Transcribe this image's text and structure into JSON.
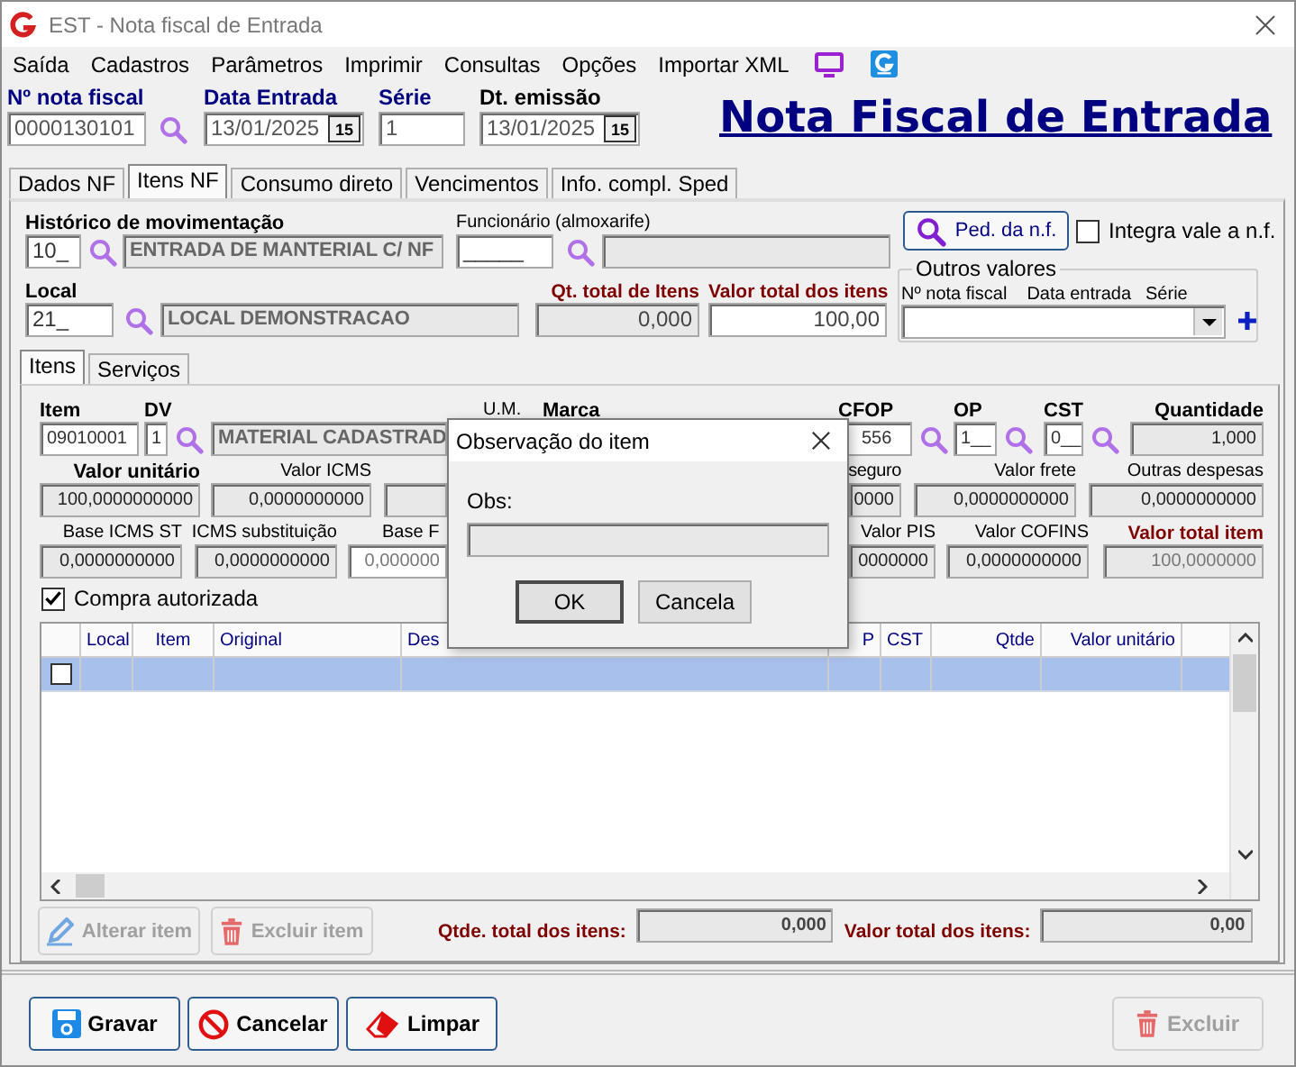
{
  "window": {
    "title": "EST - Nota fiscal de Entrada"
  },
  "menu": [
    "Saída",
    "Cadastros",
    "Parâmetros",
    "Imprimir",
    "Consultas",
    "Opções",
    "Importar XML"
  ],
  "header_fields": [
    {
      "label": "Nº nota fiscal",
      "value": "0000130101",
      "kind": "search"
    },
    {
      "label": "Data Entrada",
      "value": "13/01/2025",
      "kind": "date",
      "button": "15"
    },
    {
      "label": "Série",
      "value": "1",
      "kind": "plain"
    },
    {
      "label": "Dt. emissão",
      "value": "13/01/2025",
      "kind": "date",
      "button": "15"
    }
  ],
  "page_title": "Nota Fiscal de Entrada",
  "tabs": [
    {
      "label": "Dados NF",
      "selected": false
    },
    {
      "label": "Itens NF",
      "selected": true
    },
    {
      "label": "Consumo direto",
      "selected": false
    },
    {
      "label": "Vencimentos",
      "selected": false
    },
    {
      "label": "Info. compl. Sped",
      "selected": false
    }
  ],
  "movimentacao": {
    "label": "Histórico de movimentação",
    "code": "10_",
    "description": "ENTRADA DE MANTERIAL C/ NF"
  },
  "funcionario": {
    "label": "Funcionário (almoxarife)",
    "code": "_____"
  },
  "pedido_button": "Ped. da n.f.",
  "integra_vale": {
    "label": "Integra vale a n.f.",
    "checked": false
  },
  "local": {
    "label": "Local",
    "code": "21_",
    "description": "LOCAL DEMONSTRACAO"
  },
  "totals": [
    {
      "label": "Qt. total de Itens",
      "value": "0,000",
      "readonly": true
    },
    {
      "label": "Valor total dos itens",
      "value": "100,00",
      "readonly": false
    }
  ],
  "outros_valores": {
    "title": "Outros valores",
    "columns": [
      "Nº nota fiscal",
      "Data entrada",
      "Série"
    ]
  },
  "subtabs": [
    {
      "label": "Itens",
      "selected": true
    },
    {
      "label": "Serviços",
      "selected": false
    }
  ],
  "item_rows": [
    [
      {
        "label": "Item",
        "kind": "edit",
        "value": "09010001"
      },
      {
        "label": "DV",
        "kind": "edit",
        "value": "1"
      },
      {
        "kind": "description",
        "value": "MATERIAL CADASTRAD"
      },
      {
        "label": "U.M.",
        "kind": "label"
      },
      {
        "label": "Marca",
        "kind": "label"
      },
      {
        "label": "CFOP",
        "kind": "edit",
        "value": "556"
      },
      {
        "label": "OP",
        "kind": "edit",
        "value": "1__"
      },
      {
        "label": "CST",
        "kind": "edit",
        "value": "0__"
      },
      {
        "label": "Quantidade",
        "kind": "readonly",
        "value": "1,000"
      }
    ],
    [
      {
        "label": "Valor unitário",
        "kind": "readonly",
        "value": "100,0000000000"
      },
      {
        "label": "Valor ICMS",
        "kind": "readonly",
        "value": "0,0000000000"
      },
      {
        "kind": "readonly"
      },
      {
        "label": "seguro",
        "kind": "readonly",
        "value": "0000"
      },
      {
        "label": "Valor frete",
        "kind": "readonly",
        "value": "0,0000000000"
      },
      {
        "label": "Outras despesas",
        "kind": "readonly",
        "value": "0,0000000000"
      }
    ],
    [
      {
        "label": "Base ICMS ST",
        "kind": "readonly",
        "value": "0,0000000000"
      },
      {
        "label": "ICMS substituição",
        "kind": "readonly",
        "value": "0,0000000000"
      },
      {
        "label": "Base F",
        "kind": "edit",
        "value": "0,000000"
      },
      {
        "label": "Valor PIS",
        "kind": "readonly",
        "value": "0000000"
      },
      {
        "label": "Valor COFINS",
        "kind": "readonly",
        "value": "0,0000000000"
      },
      {
        "label": "Valor total item",
        "kind": "readonly",
        "value": "100,0000000"
      }
    ]
  ],
  "compra_autorizada": {
    "label": "Compra autorizada",
    "checked": true
  },
  "grid": {
    "columns": [
      "Local",
      "Item",
      "Original",
      "Des",
      "P",
      "CST",
      "Qtde",
      "Valor unitário"
    ],
    "rows": [
      {
        "selected": true,
        "checked": false
      }
    ]
  },
  "item_buttons": [
    {
      "label": "Alterar item",
      "disabled": true
    },
    {
      "label": "Excluir item",
      "disabled": true
    }
  ],
  "item_totals": [
    {
      "label": "Qtde. total dos itens:",
      "value": "0,000"
    },
    {
      "label": "Valor total dos itens:",
      "value": "0,00"
    }
  ],
  "footer_buttons": [
    {
      "label": "Gravar",
      "disabled": false
    },
    {
      "label": "Cancelar",
      "disabled": false
    },
    {
      "label": "Limpar",
      "disabled": false
    },
    {
      "label": "Excluir",
      "disabled": true
    }
  ],
  "dialog": {
    "title": "Observação do item",
    "field_label": "Obs:",
    "buttons": [
      "OK",
      "Cancela"
    ]
  }
}
